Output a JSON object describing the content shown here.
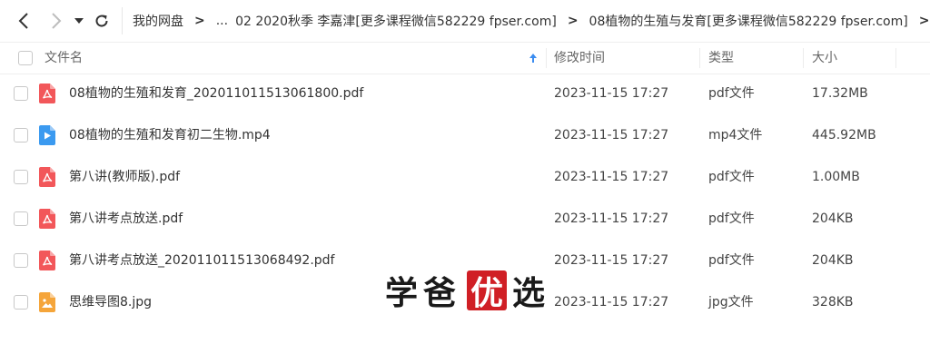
{
  "toolbar": {
    "back_icon": "chevron-left-icon",
    "forward_icon": "chevron-right-icon",
    "dropdown_icon": "caret-down-icon",
    "refresh_icon": "refresh-icon"
  },
  "breadcrumb": {
    "items": [
      "我的网盘",
      "...",
      "02 2020秋季 李嘉津[更多课程微信582229 fpser.com]",
      "08植物的生殖与发育[更多课程微信582229 fpser.com]"
    ],
    "separator": ">"
  },
  "header": {
    "name": "文件名",
    "modified": "修改时间",
    "type": "类型",
    "size": "大小",
    "sort_icon": "arrow-up-icon"
  },
  "files": [
    {
      "name": "08植物的生殖和发育_20201101151306180​0.pdf",
      "time": "2023-11-15 17:27",
      "type": "pdf文件",
      "size": "17.32MB",
      "icon": "pdf-file-icon"
    },
    {
      "name": "08植物的生殖和发育初二生物.mp4",
      "time": "2023-11-15 17:27",
      "type": "mp4文件",
      "size": "445.92MB",
      "icon": "video-file-icon"
    },
    {
      "name": "第八讲(教师版).pdf",
      "time": "2023-11-15 17:27",
      "type": "pdf文件",
      "size": "1.00MB",
      "icon": "pdf-file-icon"
    },
    {
      "name": "第八讲考点放送.pdf",
      "time": "2023-11-15 17:27",
      "type": "pdf文件",
      "size": "204KB",
      "icon": "pdf-file-icon"
    },
    {
      "name": "第八讲考点放送_20201101151306849​2.pdf",
      "time": "2023-11-15 17:27",
      "type": "pdf文件",
      "size": "204KB",
      "icon": "pdf-file-icon"
    },
    {
      "name": "思维导图8.jpg",
      "time": "2023-11-15 17:27",
      "type": "jpg文件",
      "size": "328KB",
      "icon": "image-file-icon"
    }
  ],
  "watermark": {
    "text_a": "学爸",
    "text_b": "优",
    "text_c": "选"
  },
  "colors": {
    "pdf": "#f2575a",
    "video": "#3b9af0",
    "image": "#f5a53a",
    "seal": "#d01f25"
  }
}
